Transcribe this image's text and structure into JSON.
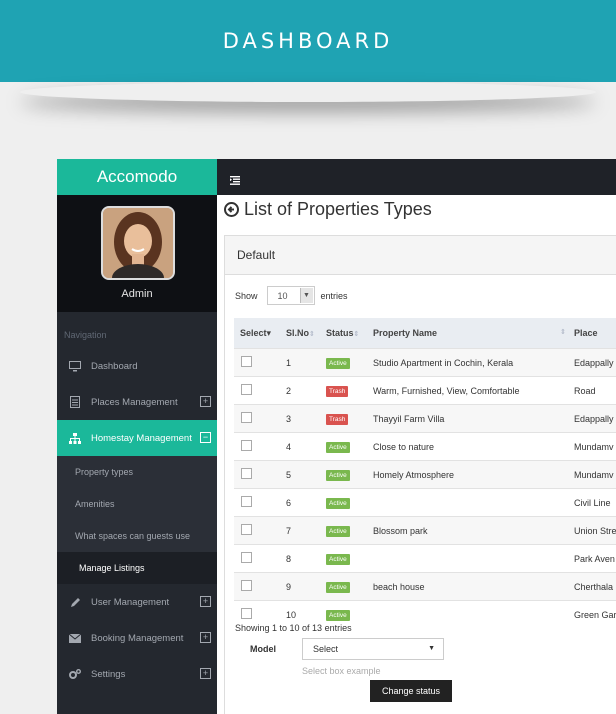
{
  "banner": {
    "title": "DASHBOARD"
  },
  "sidebar": {
    "brand": "Accomodo",
    "profile_name": "Admin",
    "nav_heading": "Navigation",
    "items": [
      {
        "label": "Dashboard",
        "icon": "monitor-icon"
      },
      {
        "label": "Places Management",
        "icon": "document-icon"
      },
      {
        "label": "Homestay Management",
        "icon": "sitemap-icon"
      },
      {
        "label": "User Management",
        "icon": "pencil-icon"
      },
      {
        "label": "Booking Management",
        "icon": "envelope-icon"
      },
      {
        "label": "Settings",
        "icon": "gears-icon"
      }
    ],
    "sub_items": [
      {
        "label": "Property types"
      },
      {
        "label": "Amenities"
      },
      {
        "label": "What spaces can guests use"
      },
      {
        "label": "Manage Listings"
      }
    ]
  },
  "page": {
    "title": "List of Properties Types"
  },
  "panel": {
    "heading": "Default",
    "show_label": "Show",
    "show_value": "10",
    "entries_label": "entries",
    "columns": [
      "Select",
      "Sl.No",
      "Status",
      "Property Name",
      "Place"
    ],
    "rows": [
      {
        "no": "1",
        "status": "Active",
        "name": "Studio Apartment in Cochin, Kerala",
        "place": "Edappally"
      },
      {
        "no": "2",
        "status": "Trash",
        "name": "Warm, Furnished, View, Comfortable",
        "place": "Road"
      },
      {
        "no": "3",
        "status": "Trash",
        "name": "Thayyil Farm Villa",
        "place": "Edappally"
      },
      {
        "no": "4",
        "status": "Active",
        "name": "Close to nature",
        "place": "Mundamv"
      },
      {
        "no": "5",
        "status": "Active",
        "name": "Homely Atmosphere",
        "place": "Mundamv"
      },
      {
        "no": "6",
        "status": "Active",
        "name": "",
        "place": "Civil Line"
      },
      {
        "no": "7",
        "status": "Active",
        "name": "Blossom park",
        "place": "Union Stre"
      },
      {
        "no": "8",
        "status": "Active",
        "name": "",
        "place": "Park Aven"
      },
      {
        "no": "9",
        "status": "Active",
        "name": "beach house",
        "place": "Cherthala"
      },
      {
        "no": "10",
        "status": "Active",
        "name": "",
        "place": "Green Gar"
      }
    ],
    "footer_info": "Showing 1 to 10 of 13 entries",
    "model_label": "Model",
    "model_value": "Select",
    "model_help": "Select box example",
    "button_label": "Change status"
  },
  "colors": {
    "accent": "#1bb89a",
    "banner": "#1fa3b3",
    "active_badge": "#7ab84e",
    "trash_badge": "#d9534f"
  }
}
